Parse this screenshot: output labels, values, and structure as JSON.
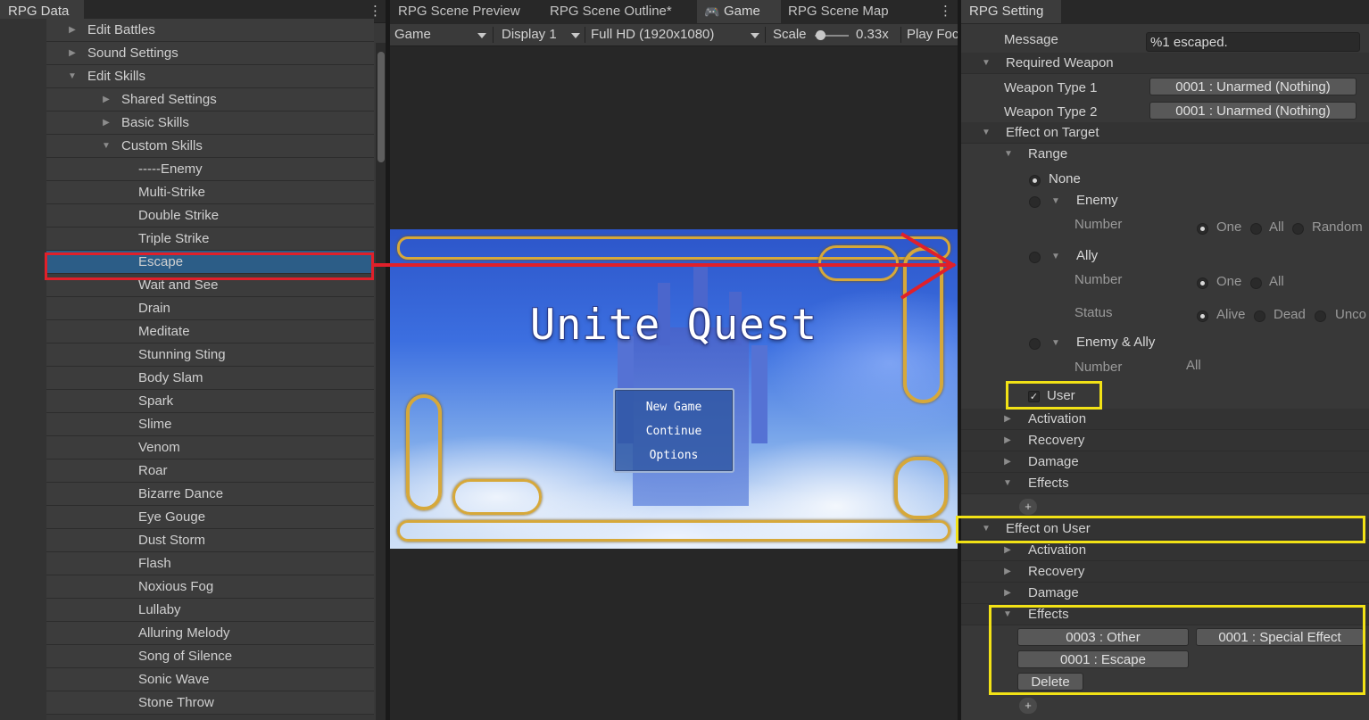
{
  "left_panel": {
    "tab": "RPG Data",
    "tree": [
      {
        "label": "Edit Battles",
        "indent": 0,
        "expanded": false,
        "has_arrow": true
      },
      {
        "label": "Sound Settings",
        "indent": 0,
        "expanded": false,
        "has_arrow": true
      },
      {
        "label": "Edit Skills",
        "indent": 0,
        "expanded": true,
        "has_arrow": true
      },
      {
        "label": "Shared Settings",
        "indent": 1,
        "expanded": false,
        "has_arrow": true
      },
      {
        "label": "Basic Skills",
        "indent": 1,
        "expanded": false,
        "has_arrow": true
      },
      {
        "label": "Custom Skills",
        "indent": 1,
        "expanded": true,
        "has_arrow": true
      },
      {
        "label": "-----Enemy",
        "indent": 2,
        "has_arrow": false
      },
      {
        "label": "Multi-Strike",
        "indent": 2,
        "has_arrow": false
      },
      {
        "label": "Double Strike",
        "indent": 2,
        "has_arrow": false
      },
      {
        "label": "Triple Strike",
        "indent": 2,
        "has_arrow": false
      },
      {
        "label": "Escape",
        "indent": 2,
        "has_arrow": false,
        "selected": true
      },
      {
        "label": "Wait and See",
        "indent": 2,
        "has_arrow": false
      },
      {
        "label": "Drain",
        "indent": 2,
        "has_arrow": false
      },
      {
        "label": "Meditate",
        "indent": 2,
        "has_arrow": false
      },
      {
        "label": "Stunning Sting",
        "indent": 2,
        "has_arrow": false
      },
      {
        "label": "Body Slam",
        "indent": 2,
        "has_arrow": false
      },
      {
        "label": "Spark",
        "indent": 2,
        "has_arrow": false
      },
      {
        "label": "Slime",
        "indent": 2,
        "has_arrow": false
      },
      {
        "label": "Venom",
        "indent": 2,
        "has_arrow": false
      },
      {
        "label": "Roar",
        "indent": 2,
        "has_arrow": false
      },
      {
        "label": "Bizarre Dance",
        "indent": 2,
        "has_arrow": false
      },
      {
        "label": "Eye Gouge",
        "indent": 2,
        "has_arrow": false
      },
      {
        "label": "Dust Storm",
        "indent": 2,
        "has_arrow": false
      },
      {
        "label": "Flash",
        "indent": 2,
        "has_arrow": false
      },
      {
        "label": "Noxious Fog",
        "indent": 2,
        "has_arrow": false
      },
      {
        "label": "Lullaby",
        "indent": 2,
        "has_arrow": false
      },
      {
        "label": "Alluring Melody",
        "indent": 2,
        "has_arrow": false
      },
      {
        "label": "Song of Silence",
        "indent": 2,
        "has_arrow": false
      },
      {
        "label": "Sonic Wave",
        "indent": 2,
        "has_arrow": false
      },
      {
        "label": "Stone Throw",
        "indent": 2,
        "has_arrow": false
      }
    ]
  },
  "center_panel": {
    "tabs": [
      "RPG Scene Preview",
      "RPG Scene Outline*",
      "Game",
      "RPG Scene Map"
    ],
    "active_tab": "Game",
    "toolbar": {
      "view": "Game",
      "display": "Display 1",
      "resolution": "Full HD (1920x1080)",
      "scale_label": "Scale",
      "scale_value": "0.33x",
      "play_focused": "Play Foc"
    },
    "game": {
      "title": "Unite Quest",
      "menu": [
        "New Game",
        "Continue",
        "Options"
      ]
    }
  },
  "right_panel": {
    "tab": "RPG Setting",
    "message_label": "Message",
    "message_value": "%1 escaped.",
    "required_weapon": "Required Weapon",
    "weapon_type_1_label": "Weapon Type 1",
    "weapon_type_1_value": "0001 : Unarmed (Nothing)",
    "weapon_type_2_label": "Weapon Type 2",
    "weapon_type_2_value": "0001 : Unarmed (Nothing)",
    "effect_on_target": "Effect on Target",
    "range": "Range",
    "range_none": "None",
    "range_enemy": "Enemy",
    "range_ally": "Ally",
    "range_enemy_ally": "Enemy & Ally",
    "number_label": "Number",
    "status_label": "Status",
    "enemy_number_options": [
      "One",
      "All",
      "Random"
    ],
    "ally_number_options": [
      "One",
      "All"
    ],
    "ally_status_options": [
      "Alive",
      "Dead",
      "Unco"
    ],
    "enemy_ally_number": "All",
    "user_checkbox": "User",
    "target_sections": [
      "Activation",
      "Recovery",
      "Damage",
      "Effects"
    ],
    "effect_on_user": "Effect on User",
    "user_sections": [
      "Activation",
      "Recovery",
      "Damage",
      "Effects"
    ],
    "user_effects_buttons": [
      "0003 : Other",
      "0001 : Special Effect",
      "0001 : Escape"
    ],
    "delete_button": "Delete",
    "plus": "+"
  },
  "colors": {
    "selection": "#2c5d87",
    "annotation_red": "#e0202a",
    "annotation_yellow": "#f2e216"
  },
  "icons": {
    "gamepad": "gamepad-icon",
    "menu": "kebab-menu-icon"
  }
}
